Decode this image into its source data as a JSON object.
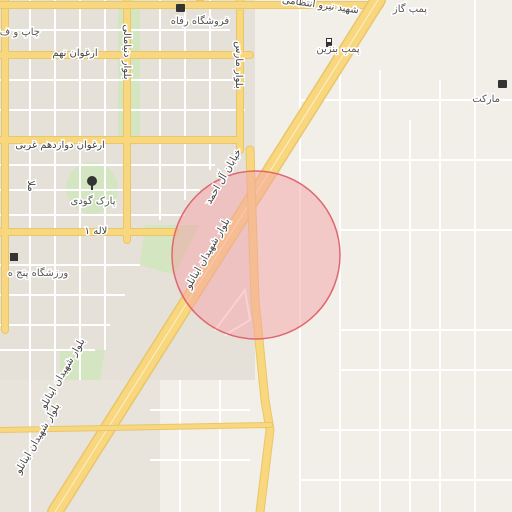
{
  "map": {
    "labels": {
      "chap": "چاپ و ف",
      "forooshgah": "فروشگاه رفاه",
      "shahid_niro": "شهید نیرو انتظامی",
      "pomp_gaz": "پمپ گاز",
      "pomp_benzin": "پمپ بنزین",
      "arghavan_noh": "ارغوان نهم",
      "bolvar_denyamali": "بلوار دنیامالی",
      "bolvar_mares": "بلوار مارس",
      "market": "مارکت",
      "arghavan_12": "ارغوان دوازدهم غربی",
      "khiaban_al_ahmad": "خیابان آل احمد",
      "park_goodi": "پارک گودی",
      "mola": "ملا",
      "lale1": "لاله ۱",
      "bolvar_shahidan_1": "بلوار شهیدان اینانلو",
      "varzeshgah": "ورزشگاه پنج ه",
      "bolvar_shahidan_2": "بلوار شهیدان اینانلو",
      "bolvar_shahidan_3": "بلوار شهیدان اینانلو"
    },
    "icons": {
      "shop": "shopping-cart-icon",
      "fuel": "fuel-pump-icon",
      "tree": "tree-icon",
      "stadium": "stadium-icon"
    },
    "colors": {
      "background": "#f2efe9",
      "major_road": "#f9d77e",
      "major_road_outline": "#e8c66a",
      "minor_road": "#ffffff",
      "park": "#d3e5c1",
      "circle_fill": "#f4a3a8",
      "circle_stroke": "#e06770"
    }
  }
}
